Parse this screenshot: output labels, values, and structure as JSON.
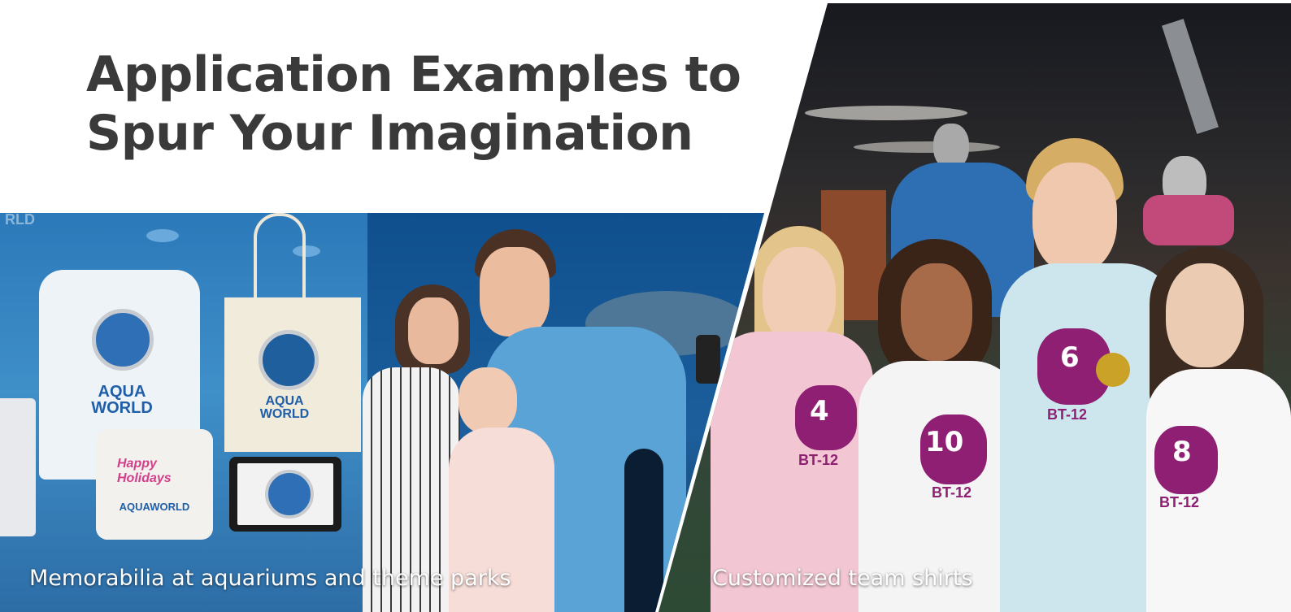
{
  "headline": {
    "line1": "Application Examples to",
    "line2": "Spur Your Imagination"
  },
  "panels": {
    "left": {
      "caption": "Memorabilia at aquariums and theme parks",
      "shirt_logo_line1": "AQUA",
      "shirt_logo_line2": "WORLD",
      "bag_logo_line1": "AQUA",
      "bag_logo_line2": "WORLD",
      "pillow_text": "AQUAWORLD",
      "pillow_script": "Happy Holidays",
      "watermark": "RLD"
    },
    "right": {
      "caption": "Customized team shirts",
      "shirt_numbers": [
        "4",
        "10",
        "6",
        "8"
      ],
      "team_text": "BT-12"
    }
  },
  "colors": {
    "headline": "#3a3a3a",
    "aquarium_blue": "#2c79b9",
    "caption": "#ffffff",
    "team_badge_purple": "#8e1f73",
    "team_badge_yellow": "#c9a227"
  }
}
